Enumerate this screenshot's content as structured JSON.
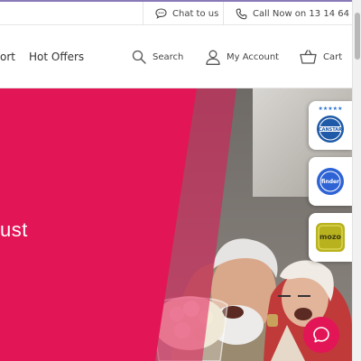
{
  "topbar": {
    "chat_label": "Chat to us",
    "call_label": "Call Now on 13 14 64",
    "chat_icon": "speech-bubble-icon",
    "call_icon": "phone-icon"
  },
  "nav": {
    "partial_label": "ort",
    "hot_offers": "Hot Offers",
    "search": "Search",
    "my_account": "My Account",
    "cart": "Cart"
  },
  "hero": {
    "partial_heading": "ust",
    "accent_color": "#e21556"
  },
  "badges": [
    {
      "name": "canstar",
      "label": "CANSTAR",
      "color": "#1f5aa8"
    },
    {
      "name": "finder",
      "label": "finder",
      "color": "#2e63d6"
    },
    {
      "name": "mozo",
      "label": "mozo",
      "color": "#b9b21f"
    }
  ],
  "chat_widget": {
    "icon": "chat-bubble-icon",
    "color": "#e21556"
  }
}
